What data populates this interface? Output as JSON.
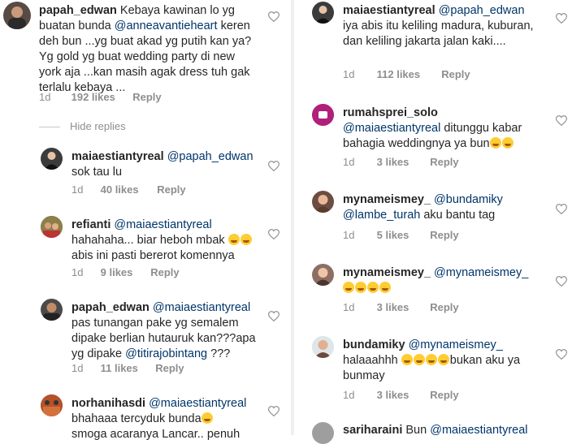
{
  "left": {
    "c1": {
      "user": "papah_edwan",
      "t1": "Kebaya kawinan lo yg buatan bunda",
      "m1": "@anneavantieheart",
      "t2": "keren deh bun ...yg buat akad yg putih kan ya? Yg gold yg buat wedding party di new york aja ...kan masih agak dress tuh gak terlalu kebaya ...",
      "time": "1d",
      "likes": "192 likes",
      "reply": "Reply"
    },
    "hide_replies": "Hide replies",
    "c2": {
      "user": "maiaestiantyreal",
      "m1": "@papah_edwan",
      "t1": "sok tau lu",
      "time": "1d",
      "likes": "40 likes",
      "reply": "Reply"
    },
    "c3": {
      "user": "refianti",
      "m1": "@maiaestiantyreal",
      "t1": "hahahaha... biar heboh mbak",
      "t2": "abis ini pasti bererot komennya",
      "time": "1d",
      "likes": "9 likes",
      "reply": "Reply"
    },
    "c4": {
      "user": "papah_edwan",
      "m1": "@maiaestiantyreal",
      "t1": "pas tunangan pake yg semalem dipake berlian hutauruk kan???apa yg dipake",
      "m2": "@titirajobintang",
      "t2": "???",
      "time": "1d",
      "likes": "11 likes",
      "reply": "Reply"
    },
    "c5": {
      "user": "norhanihasdi",
      "m1": "@maiaestiantyreal",
      "t1": "bhahaaa tercyduk bunda",
      "t2": "smoga acaranya Lancar.. penuh"
    }
  },
  "right": {
    "c1": {
      "user": "maiaestiantyreal",
      "m1": "@papah_edwan",
      "t1": "iya abis itu keliling madura, kuburan, dan keliling jakarta jalan kaki....",
      "time": "1d",
      "likes": "112 likes",
      "reply": "Reply"
    },
    "c2": {
      "user": "rumahsprei_solo",
      "m1": "@maiaestiantyreal",
      "t1": "ditunggu kabar bahagia weddingnya ya bun",
      "time": "1d",
      "likes": "3 likes",
      "reply": "Reply"
    },
    "c3": {
      "user": "mynameismey_",
      "m1": "@bundamiky",
      "m2": "@lambe_turah",
      "t1": "aku bantu tag",
      "time": "1d",
      "likes": "5 likes",
      "reply": "Reply"
    },
    "c4": {
      "user": "mynameismey_",
      "m1": "@mynameismey_",
      "time": "1d",
      "likes": "3 likes",
      "reply": "Reply"
    },
    "c5": {
      "user": "bundamiky",
      "m1": "@mynameismey_",
      "t1": "halaaahhh",
      "t2": "bukan aku ya bunmay",
      "time": "1d",
      "likes": "3 likes",
      "reply": "Reply"
    },
    "c6": {
      "user": "sariharaini",
      "t1": "Bun",
      "m1": "@maiaestiantyreal"
    }
  },
  "colors": {
    "text": "#262626",
    "mention": "#003569",
    "meta": "#8e8e8e",
    "emoji": "#ffcc33"
  },
  "icons": {
    "like": "heart-outline-icon",
    "emoji": "laughing-emoji-icon"
  }
}
